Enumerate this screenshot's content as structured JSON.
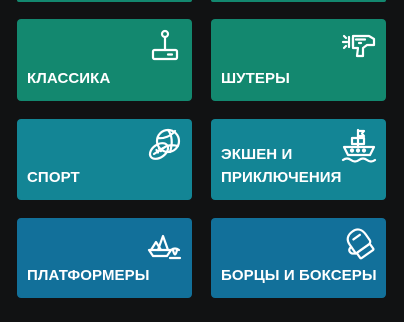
{
  "colors": {
    "background": "#111213",
    "row1": "#13886f",
    "row2": "#138595",
    "row3": "#12709a",
    "text": "#ffffff"
  },
  "categories": [
    {
      "label_lines": [
        "КЛАССИКА"
      ],
      "icon": "joystick-icon"
    },
    {
      "label_lines": [
        "ШУТЕРЫ"
      ],
      "icon": "ray-gun-icon"
    },
    {
      "label_lines": [
        "СПОРТ"
      ],
      "icon": "sports-balls-icon"
    },
    {
      "label_lines": [
        "ЭКШЕН И",
        "ПРИКЛЮЧЕНИЯ"
      ],
      "icon": "pirate-ship-icon"
    },
    {
      "label_lines": [
        "ПЛАТФОРМЕРЫ"
      ],
      "icon": "platform-island-icon"
    },
    {
      "label_lines": [
        "БОРЦЫ И БОКСЕРЫ"
      ],
      "icon": "boxing-glove-icon"
    }
  ]
}
